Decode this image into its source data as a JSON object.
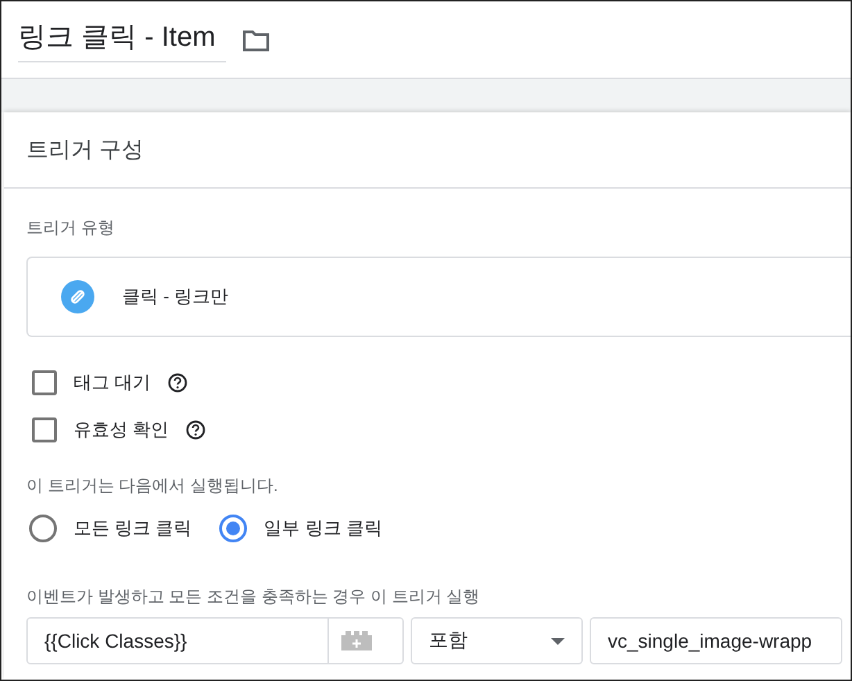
{
  "title": {
    "value": "링크 클릭 - Item"
  },
  "card": {
    "heading": "트리거 구성",
    "trigger_type_label": "트리거 유형",
    "trigger_type": {
      "name": "클릭 - 링크만"
    },
    "options": [
      {
        "label": "태그 대기",
        "checked": false
      },
      {
        "label": "유효성 확인",
        "checked": false
      }
    ],
    "fires_on_label": "이 트리거는 다음에서 실행됩니다.",
    "fires_on": [
      {
        "label": "모든 링크 클릭",
        "selected": false
      },
      {
        "label": "일부 링크 클릭",
        "selected": true
      }
    ],
    "condition_label": "이벤트가 발생하고 모든 조건을 충족하는 경우 이 트리거 실행",
    "condition": {
      "variable": "{{Click Classes}}",
      "operator": "포함",
      "value": "vc_single_image-wrapp"
    }
  }
}
